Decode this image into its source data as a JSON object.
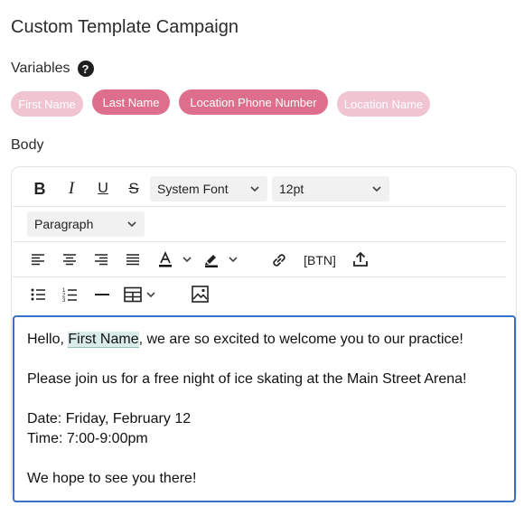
{
  "page": {
    "title": "Custom Template Campaign",
    "variables_label": "Variables",
    "help_glyph": "?",
    "body_label": "Body"
  },
  "variables": [
    {
      "label": "First Name",
      "state": "disabled"
    },
    {
      "label": "Last Name",
      "state": "enabled"
    },
    {
      "label": "Location Phone Number",
      "state": "enabled"
    },
    {
      "label": "Location Name",
      "state": "disabled"
    }
  ],
  "toolbar": {
    "bold": "B",
    "italic": "I",
    "underline": "U",
    "strike": "S",
    "font_family": "System Font",
    "font_size": "12pt",
    "block_format": "Paragraph",
    "button_insert": "[BTN]"
  },
  "editor_content": {
    "greeting_before": "Hello, ",
    "greeting_variable": "First Name",
    "greeting_after": ", we are so excited to welcome you to our practice!",
    "line2": "Please join us for a free night of ice skating at the Main Street Arena!",
    "line3": "Date: Friday, February 12",
    "line4": "Time: 7:00-9:00pm",
    "line5": "We hope to see you there!"
  },
  "colors": {
    "chip_enabled": "#dd6f8d",
    "chip_disabled": "#f0c4d1",
    "editor_focus_border": "#3b6fc9",
    "variable_highlight": "#d9ecea"
  }
}
